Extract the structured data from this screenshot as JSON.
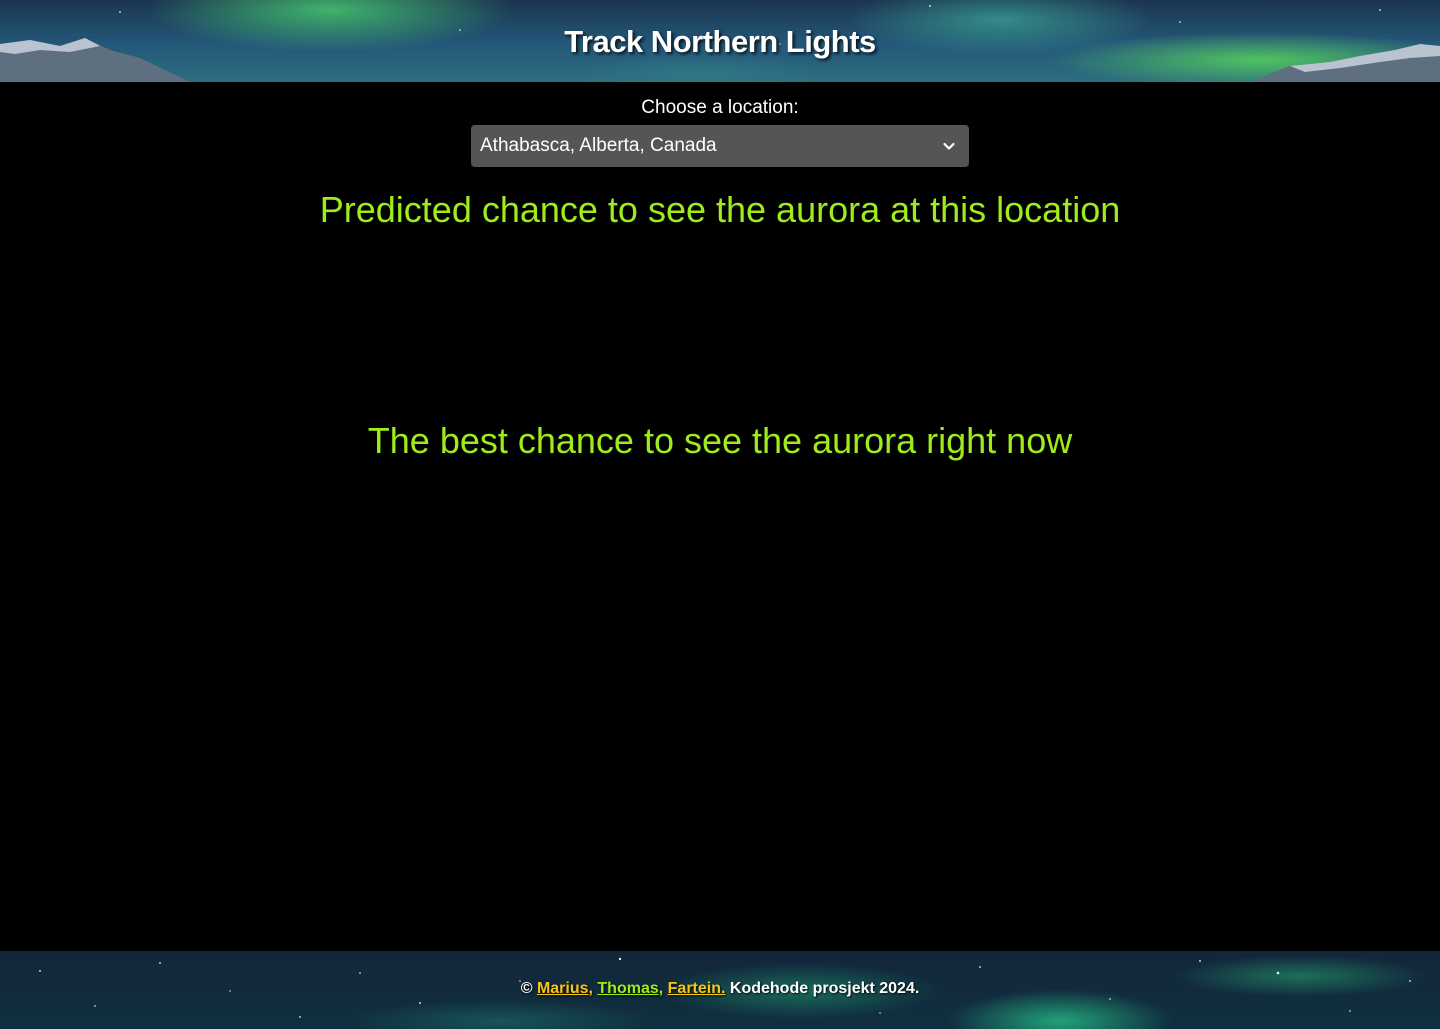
{
  "header": {
    "title": "Track Northern Lights"
  },
  "location": {
    "label": "Choose a location:",
    "selected": "Athabasca, Alberta, Canada"
  },
  "sections": {
    "predicted_heading": "Predicted chance to see the aurora at this location",
    "best_heading": "The best chance to see the aurora right now"
  },
  "footer": {
    "copyright_symbol": "©",
    "authors": [
      {
        "name": "Marius,",
        "color": "#f5c518"
      },
      {
        "name": "Thomas,",
        "color": "#9eec1b"
      },
      {
        "name": "Fartein.",
        "color": "#f5c518"
      }
    ],
    "suffix": "Kodehode prosjekt 2024."
  },
  "colors": {
    "background": "#000000",
    "heading_green": "#9eec1b",
    "select_bg": "#555555",
    "link_yellow": "#f5c518"
  },
  "icons": {
    "select_arrow": "chevron-down-icon"
  }
}
